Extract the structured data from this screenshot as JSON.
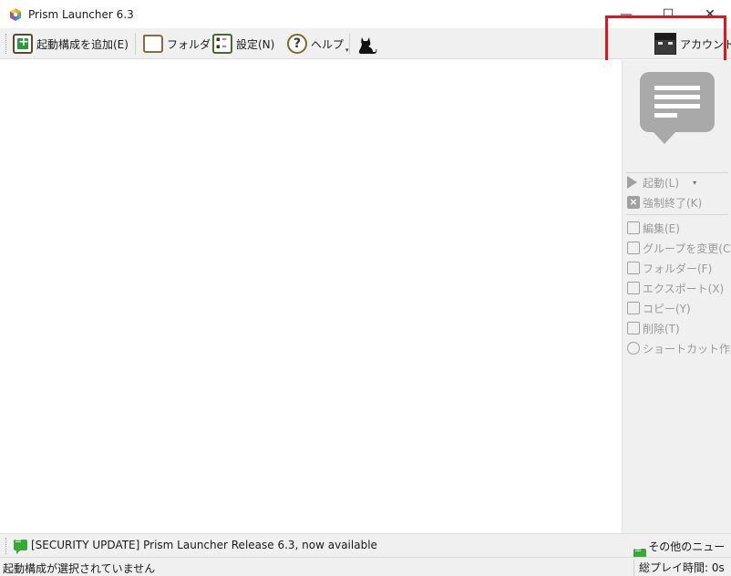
{
  "window": {
    "title": "Prism Launcher 6.3",
    "minimize": "—",
    "maximize": "☐",
    "close": "✕"
  },
  "toolbar": {
    "add_instance": "起動構成を追加(E)",
    "folders": "フォルダ",
    "settings": "設定(N)",
    "help": "ヘルプ",
    "accounts": "アカウント",
    "dropdown_caret": "▾"
  },
  "sidebar": {
    "launch": "起動(L)",
    "launch_caret": "▾",
    "kill": "強制終了(K)",
    "edit": "編集(E)",
    "change_group": "グループを変更(C)",
    "folder": "フォルダー(F)",
    "export": "エクスポート(X)",
    "copy": "コピー(Y)",
    "delete": "削除(T)",
    "shortcut": "ショートカット作成"
  },
  "news": {
    "headline": "[SECURITY UPDATE] Prism Launcher Release 6.3, now available",
    "more_news": "その他のニュース"
  },
  "status": {
    "selection": "起動構成が選択されていません",
    "playtime": "総プレイ時間: 0s"
  },
  "colors": {
    "highlight_box": "#e3141e",
    "news_icon": "#38a838"
  }
}
